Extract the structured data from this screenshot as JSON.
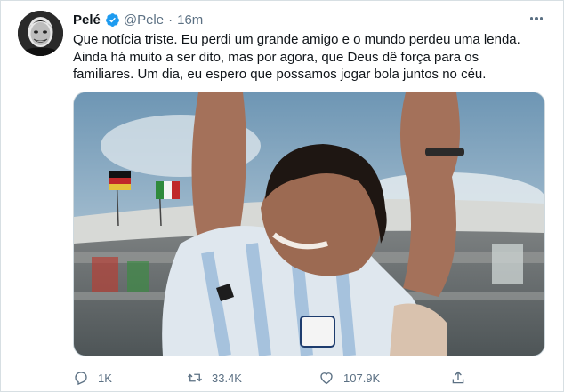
{
  "tweet": {
    "author_name": "Pelé",
    "handle": "@Pele",
    "separator": "·",
    "time": "16m",
    "text_lines": [
      "Que notícia triste. Eu perdi um grande amigo e o mundo perdeu uma lenda.",
      "Ainda há muito a ser dito, mas por agora, que Deus dê força para os",
      "familiares. Um dia, eu espero que possamos jogar bola juntos no céu."
    ]
  },
  "actions": {
    "reply_count": "1K",
    "retweet_count": "33.4K",
    "like_count": "107.9K"
  },
  "icons": {
    "verified": "verified-badge-icon",
    "more": "more-options-icon",
    "reply": "reply-icon",
    "retweet": "retweet-icon",
    "like": "heart-icon",
    "share": "share-icon"
  },
  "colors": {
    "verified_blue": "#1d9bf0",
    "secondary_text": "#5b7083",
    "primary_text": "#0f1419"
  }
}
